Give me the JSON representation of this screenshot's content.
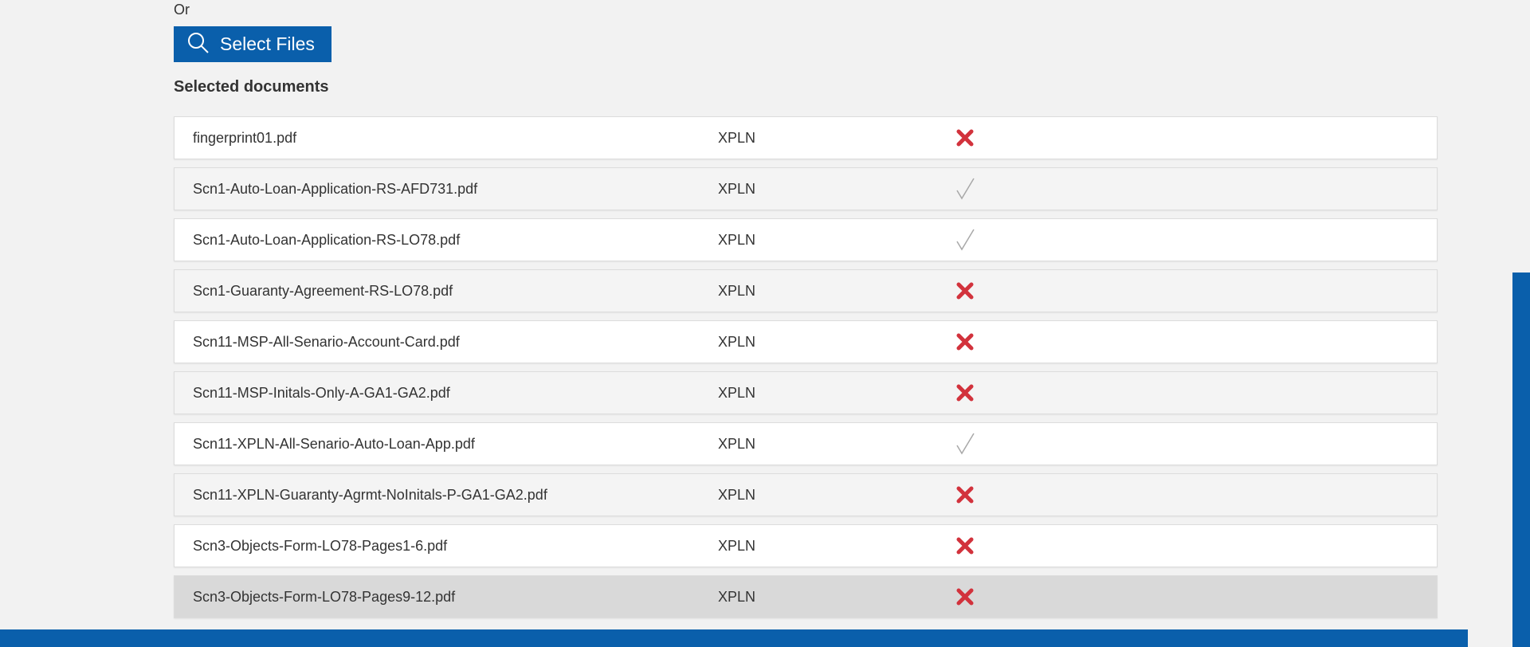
{
  "upload": {
    "or_label": "Or",
    "select_files_label": "Select Files"
  },
  "documents": {
    "title": "Selected documents",
    "items": [
      {
        "name": "fingerprint01.pdf",
        "type": "XPLN",
        "status": "invalid"
      },
      {
        "name": "Scn1-Auto-Loan-Application-RS-AFD731.pdf",
        "type": "XPLN",
        "status": "valid"
      },
      {
        "name": "Scn1-Auto-Loan-Application-RS-LO78.pdf",
        "type": "XPLN",
        "status": "valid"
      },
      {
        "name": "Scn1-Guaranty-Agreement-RS-LO78.pdf",
        "type": "XPLN",
        "status": "invalid"
      },
      {
        "name": "Scn11-MSP-All-Senario-Account-Card.pdf",
        "type": "XPLN",
        "status": "invalid"
      },
      {
        "name": "Scn11-MSP-Initals-Only-A-GA1-GA2.pdf",
        "type": "XPLN",
        "status": "invalid"
      },
      {
        "name": "Scn11-XPLN-All-Senario-Auto-Loan-App.pdf",
        "type": "XPLN",
        "status": "valid"
      },
      {
        "name": "Scn11-XPLN-Guaranty-Agrmt-NoInitals-P-GA1-GA2.pdf",
        "type": "XPLN",
        "status": "invalid"
      },
      {
        "name": "Scn3-Objects-Form-LO78-Pages1-6.pdf",
        "type": "XPLN",
        "status": "invalid"
      },
      {
        "name": "Scn3-Objects-Form-LO78-Pages9-12.pdf",
        "type": "XPLN",
        "status": "invalid"
      }
    ]
  },
  "icons": {
    "search": "search-icon",
    "invalid": "x-mark-icon",
    "valid": "check-mark-icon"
  },
  "colors": {
    "brand_blue": "#0a5fab",
    "invalid_red": "#d2323c",
    "valid_gray": "#a8a8a8",
    "page_bg": "#f2f2f2"
  }
}
